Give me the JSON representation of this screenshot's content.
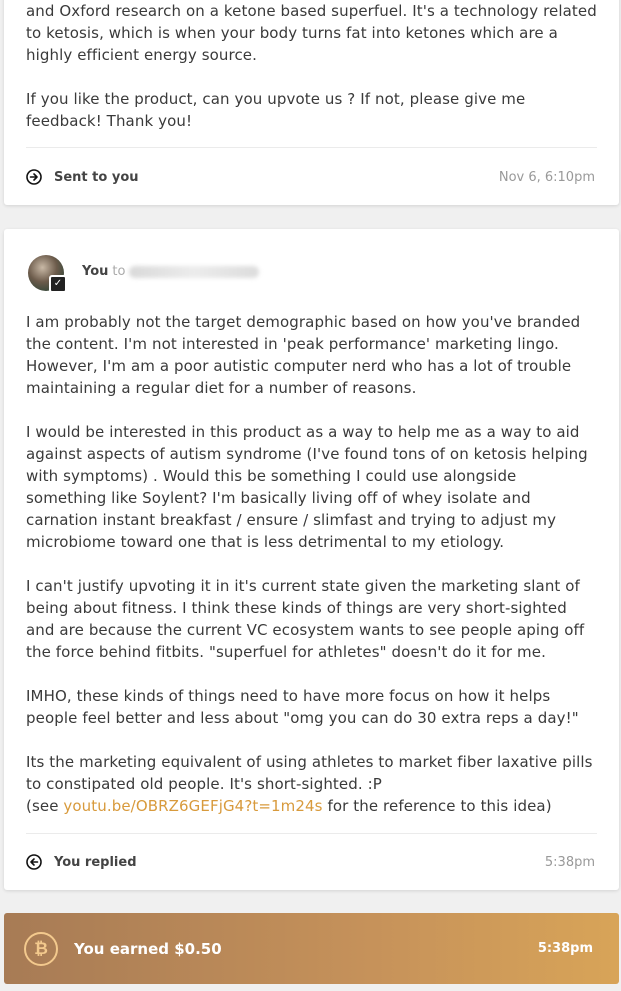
{
  "message1": {
    "paragraphs": [
      "and Oxford research on a ketone based superfuel. It's a technology related to ketosis, which is when your body turns fat into ketones which are a highly efficient energy source.",
      "If you like the product, can you upvote us ? If not, please give me feedback! Thank you!"
    ],
    "status": "Sent to you",
    "time": "Nov 6, 6:10pm"
  },
  "message2": {
    "sender": "You",
    "to_label": "to",
    "paragraphs": [
      "I am probably not the target demographic based on how you've branded the content. I'm not interested in 'peak performance' marketing lingo. However,  I'm am a poor autistic computer nerd who has a lot of trouble maintaining a regular diet for a number of reasons.",
      "I would be interested in this product as a way to help me as a way to aid against aspects of autism syndrome (I've found tons of on ketosis helping with symptoms) . Would this be something I could use alongside something like Soylent?  I'm basically living off of whey isolate and carnation instant breakfast / ensure / slimfast and trying to adjust my microbiome toward one that is less detrimental to my etiology.",
      "I can't justify upvoting it in it's current state given the marketing slant of being about fitness. I think these kinds of things are very short-sighted and are because the current VC ecosystem wants to see people aping off the force behind fitbits. \"superfuel for athletes\" doesn't do it for me.",
      "IMHO, these kinds of things need to have more focus on how it helps people feel better and less about \"omg you can do 30 extra reps a day!\"",
      "Its the marketing equivalent of using athletes to market fiber laxative pills to constipated old people. It's short-sighted. :P"
    ],
    "last_line_prefix": "(see ",
    "link_text": "youtu.be/OBRZ6GEFjG4?t=1m24s",
    "last_line_suffix": " for the reference to this idea)",
    "status": "You replied",
    "time": "5:38pm"
  },
  "earned": {
    "label": "You earned $0.50",
    "time": "5:38pm",
    "icon_glyph": "₿"
  },
  "colors": {
    "link": "#d89a3c",
    "earned_start": "#a77b55",
    "earned_end": "#d8a458"
  }
}
